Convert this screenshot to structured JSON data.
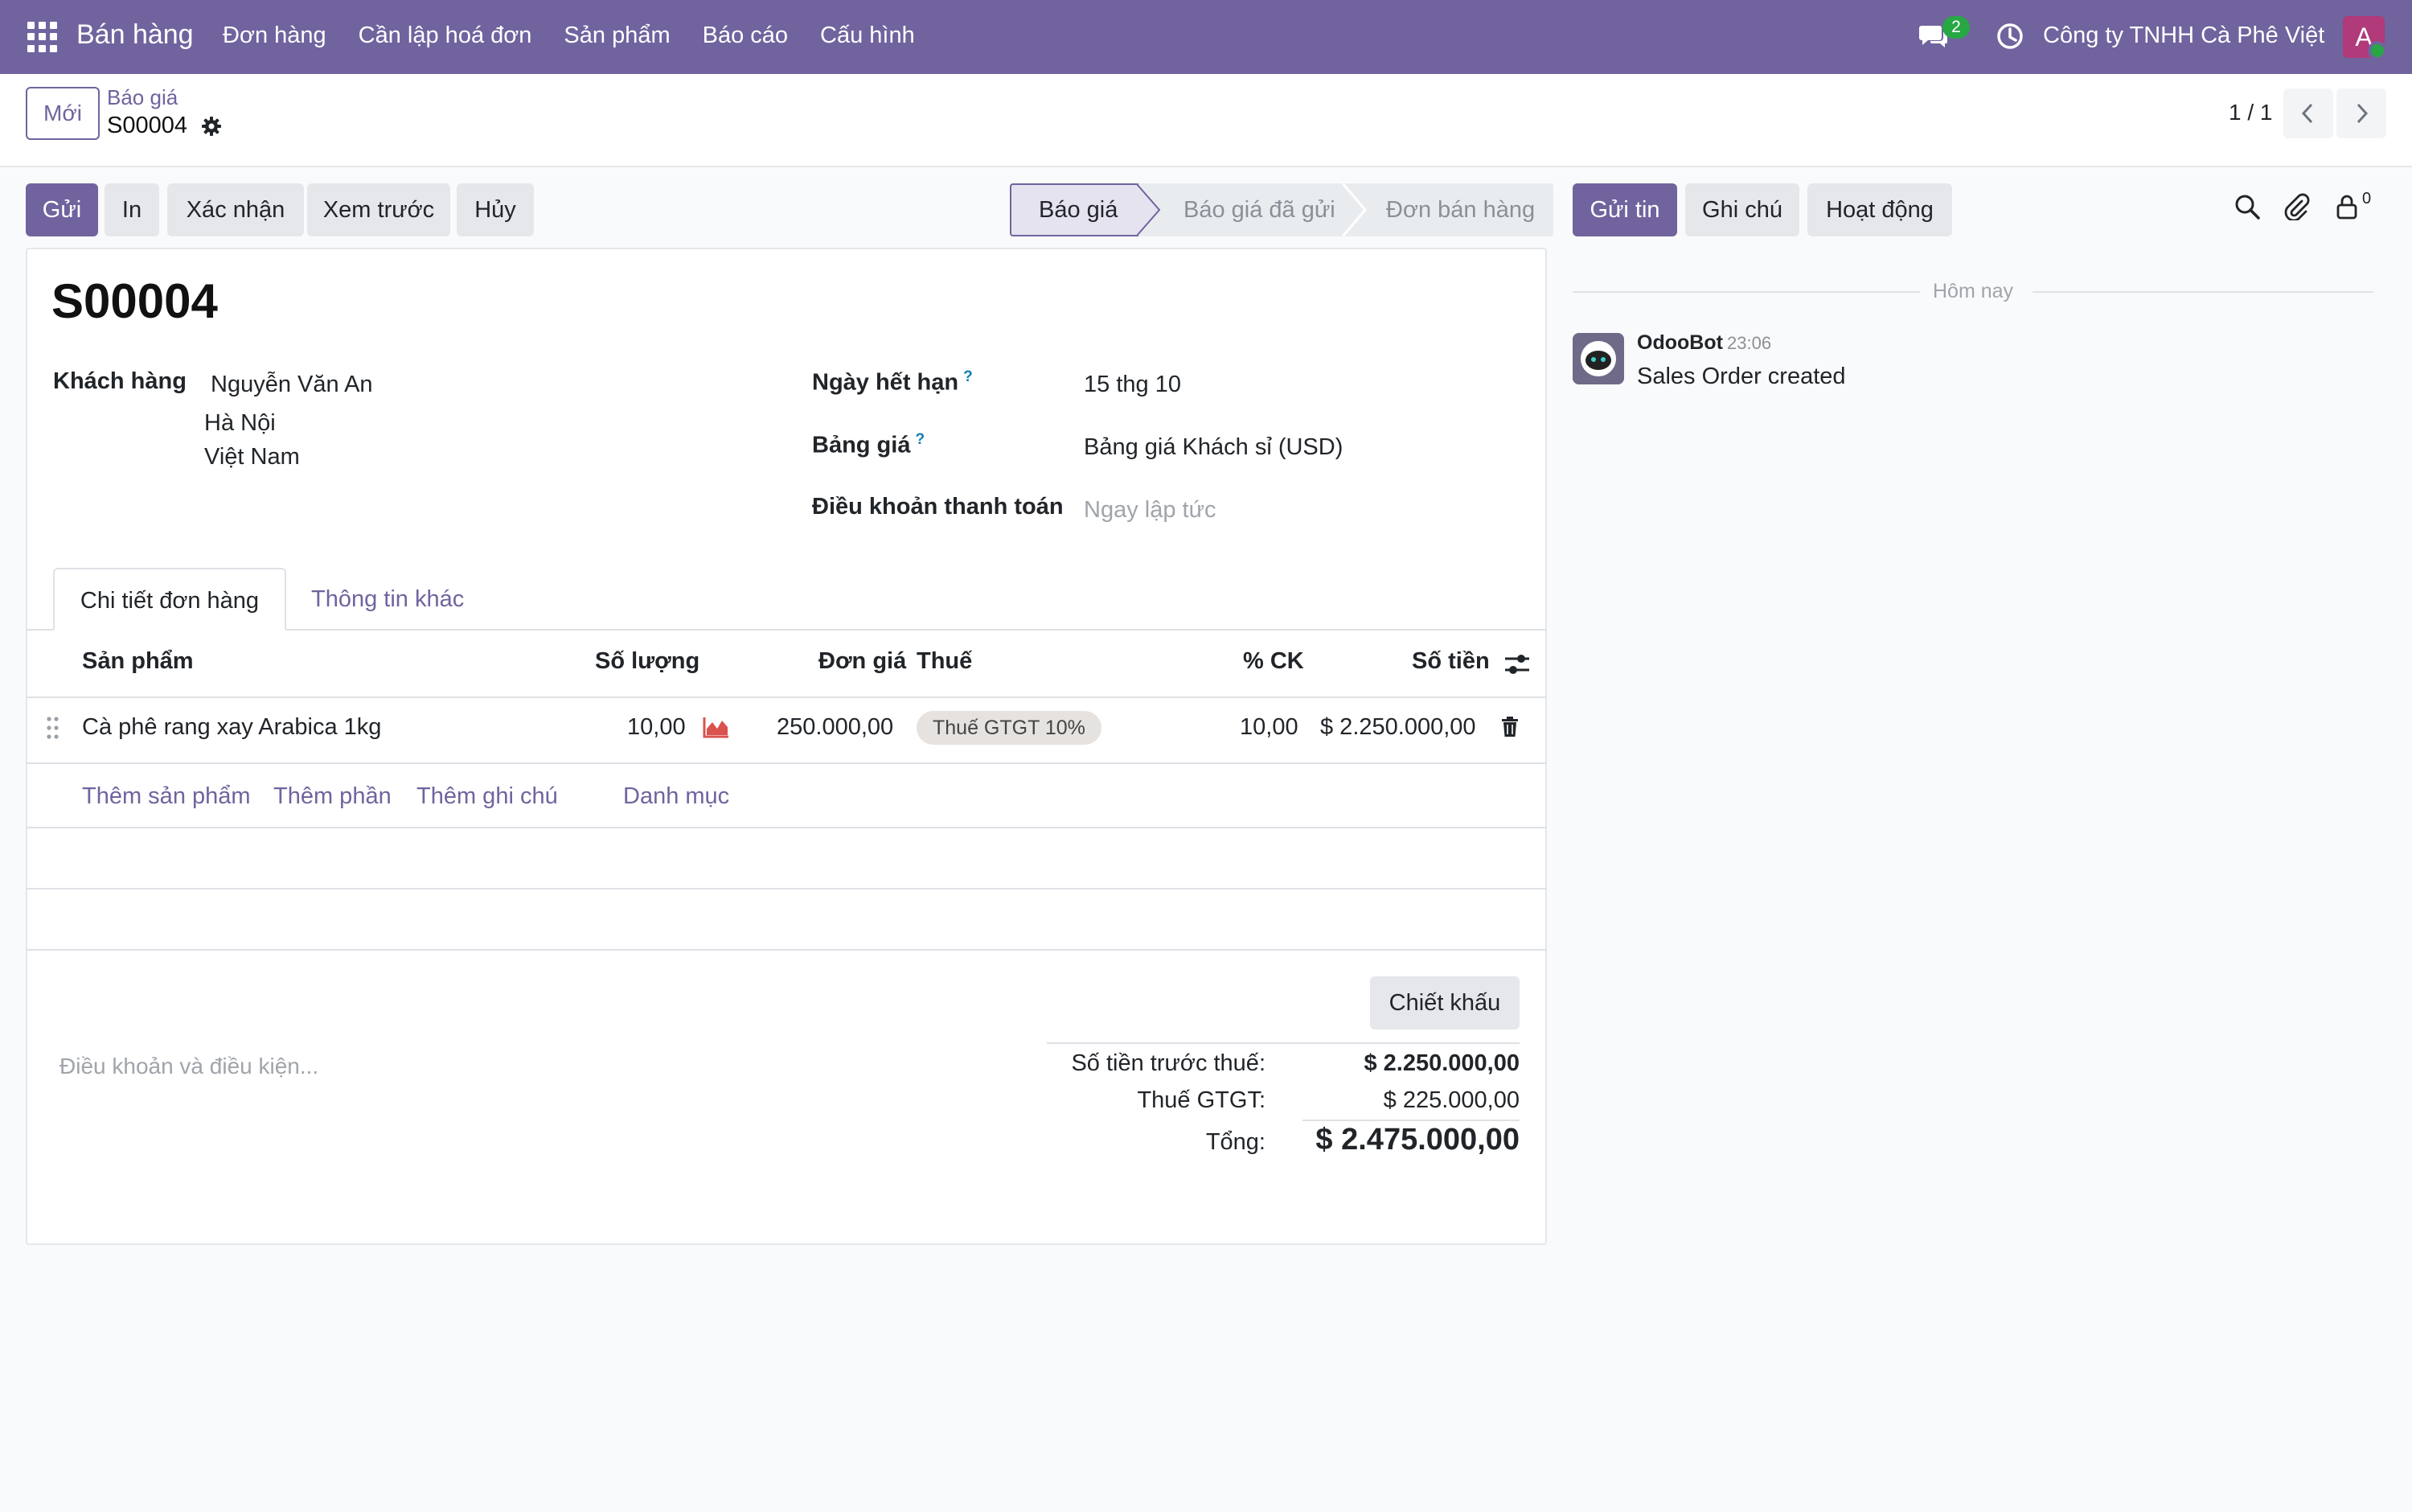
{
  "nav": {
    "app_name": "Bán hàng",
    "menu": [
      "Đơn hàng",
      "Cần lập hoá đơn",
      "Sản phẩm",
      "Báo cáo",
      "Cấu hình"
    ],
    "message_count": "2",
    "company": "Công ty TNHH Cà Phê Việt",
    "avatar_letter": "A"
  },
  "control": {
    "new_label": "Mới",
    "breadcrumb_parent": "Báo giá",
    "breadcrumb_current": "S00004",
    "pager": "1 / 1"
  },
  "actions": {
    "send": "Gửi",
    "print": "In",
    "confirm": "Xác nhận",
    "preview": "Xem trước",
    "cancel": "Hủy"
  },
  "status_stages": [
    "Báo giá",
    "Báo giá đã gửi",
    "Đơn bán hàng"
  ],
  "active_stage": "Báo giá",
  "order": {
    "name": "S00004",
    "customer_label": "Khách hàng",
    "customer_name": "Nguyễn Văn An",
    "customer_city": "Hà Nội",
    "customer_country": "Việt Nam",
    "expiry_label": "Ngày hết hạn",
    "expiry_value": "15 thg 10",
    "pricelist_label": "Bảng giá",
    "pricelist_value": "Bảng giá Khách sỉ (USD)",
    "payment_terms_label": "Điều khoản thanh toán",
    "payment_terms_placeholder": "Ngay lập tức",
    "help_mark": "?"
  },
  "tabs": [
    "Chi tiết đơn hàng",
    "Thông tin khác"
  ],
  "lines": {
    "headers": {
      "product": "Sản phẩm",
      "quantity": "Số lượng",
      "unit_price": "Đơn giá",
      "taxes": "Thuế",
      "discount": "% CK",
      "subtotal": "Số tiền"
    },
    "rows": [
      {
        "product": "Cà phê rang xay Arabica 1kg",
        "quantity": "10,00",
        "unit_price": "250.000,00",
        "tax": "Thuế GTGT 10%",
        "discount": "10,00",
        "subtotal": "$ 2.250.000,00"
      }
    ],
    "add_product": "Thêm sản phẩm",
    "add_section": "Thêm phần",
    "add_note": "Thêm ghi chú",
    "catalog": "Danh mục"
  },
  "totals": {
    "discount_button": "Chiết khấu",
    "terms_placeholder": "Điều khoản và điều kiện...",
    "untaxed_label": "Số tiền trước thuế:",
    "untaxed_value": "$ 2.250.000,00",
    "tax_label": "Thuế GTGT:",
    "tax_value": "$ 225.000,00",
    "total_label": "Tổng:",
    "total_value": "$ 2.475.000,00"
  },
  "chatter": {
    "send_message": "Gửi tin",
    "log_note": "Ghi chú",
    "activity": "Hoạt động",
    "followers_count": "0",
    "today": "Hôm nay",
    "author": "OdooBot",
    "time": "23:06",
    "message": "Sales Order created"
  }
}
